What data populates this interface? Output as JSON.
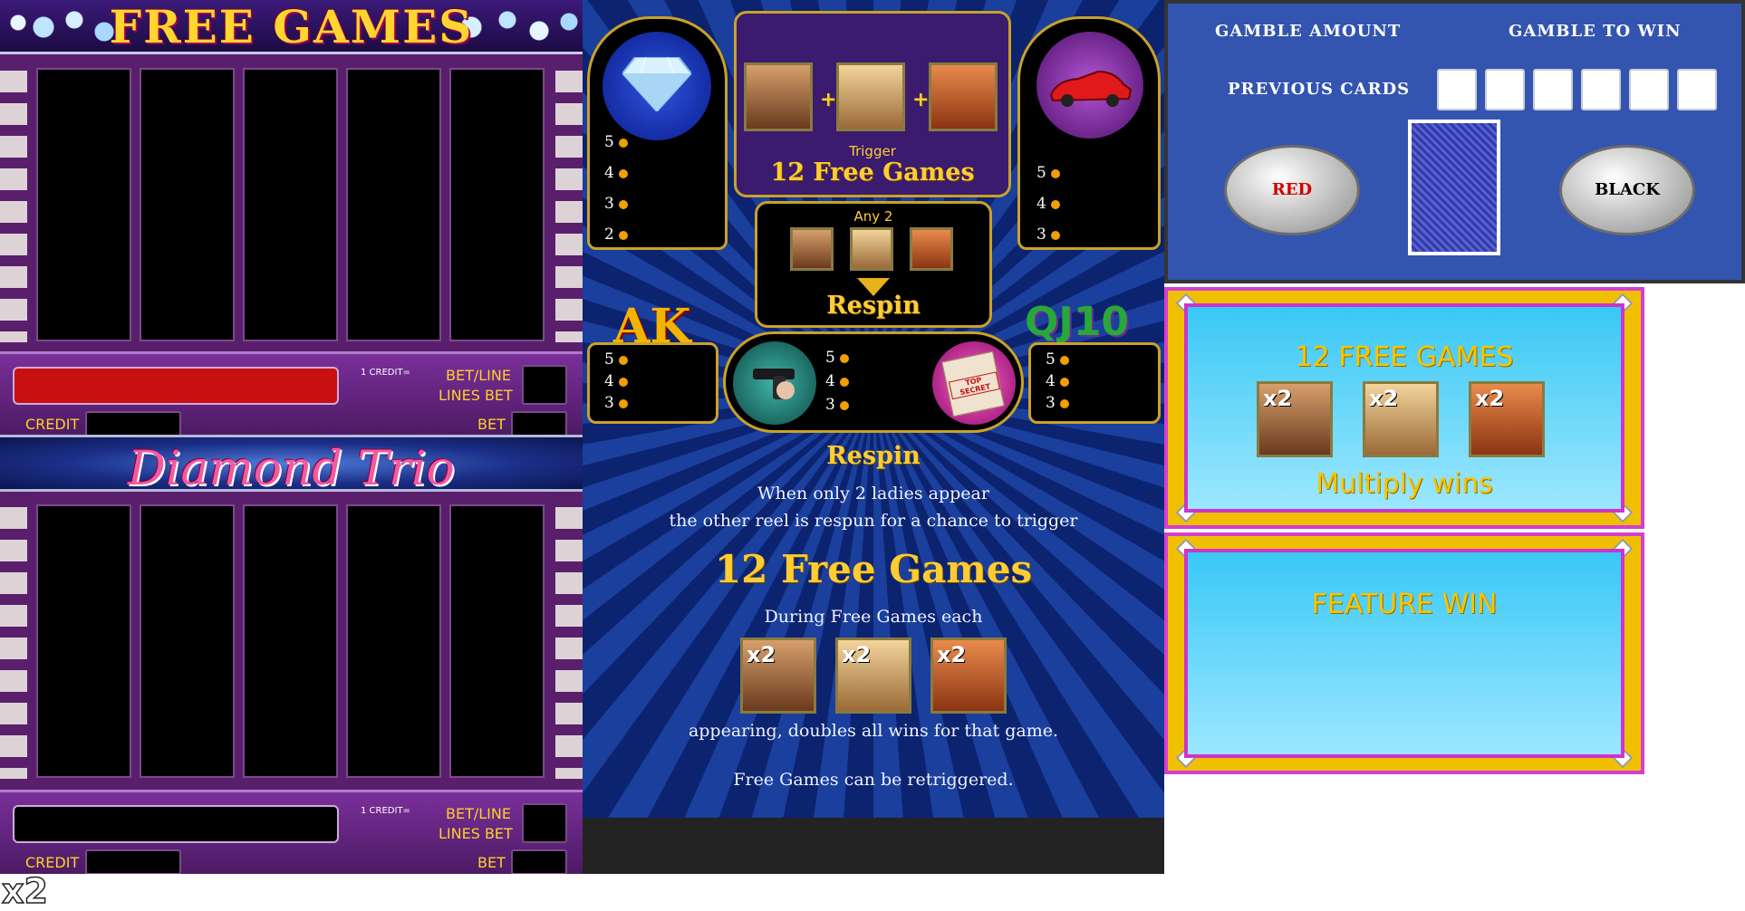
{
  "left_panel": {
    "free_games_title": "FREE GAMES",
    "game_logo": "Diamond Trio",
    "controls": {
      "credit_note": "1 CREDIT=",
      "bet_per_line_label": "BET/LINE",
      "lines_bet_label": "LINES BET",
      "credit_label": "CREDIT",
      "bet_label": "BET"
    },
    "colors": {
      "message_box_red": "#c8100f"
    }
  },
  "paytable": {
    "diamond_pays": [
      "5",
      "4",
      "3",
      "2"
    ],
    "car_pays": [
      "5",
      "4",
      "3"
    ],
    "scatter_trigger": {
      "plus": "+",
      "trigger_label": "Trigger",
      "free_games_label": "12 Free Games"
    },
    "respin_box": {
      "any_label": "Any 2",
      "respin_label": "Respin"
    },
    "ak_label": "AK",
    "ak_pays": [
      "5",
      "4",
      "3"
    ],
    "gun_pays": [
      "5",
      "4",
      "3"
    ],
    "top_secret_label": "TOP SECRET",
    "qj10_label": "QJ10",
    "qj10_pays": [
      "5",
      "4",
      "3"
    ],
    "respin_heading": "Respin",
    "respin_line1": "When only 2 ladies appear",
    "respin_line2": "the other reel is respun for a chance to trigger",
    "free_games_big": "12 Free Games",
    "during_text": "During Free Games each",
    "multiplier_badge": "x2",
    "doubles_text": "appearing, doubles all wins for that game.",
    "retrigger_text": "Free Games can be retriggered."
  },
  "gamble": {
    "gamble_amount_label": "GAMBLE AMOUNT",
    "gamble_to_win_label": "GAMBLE TO WIN",
    "previous_cards_label": "PREVIOUS CARDS",
    "red_button_label": "RED",
    "black_button_label": "BLACK",
    "colors": {
      "red_text": "#d00000",
      "black_text": "#000000"
    }
  },
  "feature_free_games": {
    "title": "12 FREE GAMES",
    "multiplier_badge": "x2",
    "subtitle": "Multiply wins"
  },
  "feature_win": {
    "title": "FEATURE WIN"
  },
  "bottom_badge": "x2",
  "icons": [
    "diamond-icon",
    "red-car-icon",
    "scatter-lady-icon",
    "gun-hand-icon",
    "top-secret-folder-icon",
    "card-back-icon",
    "arrow-down-icon"
  ]
}
